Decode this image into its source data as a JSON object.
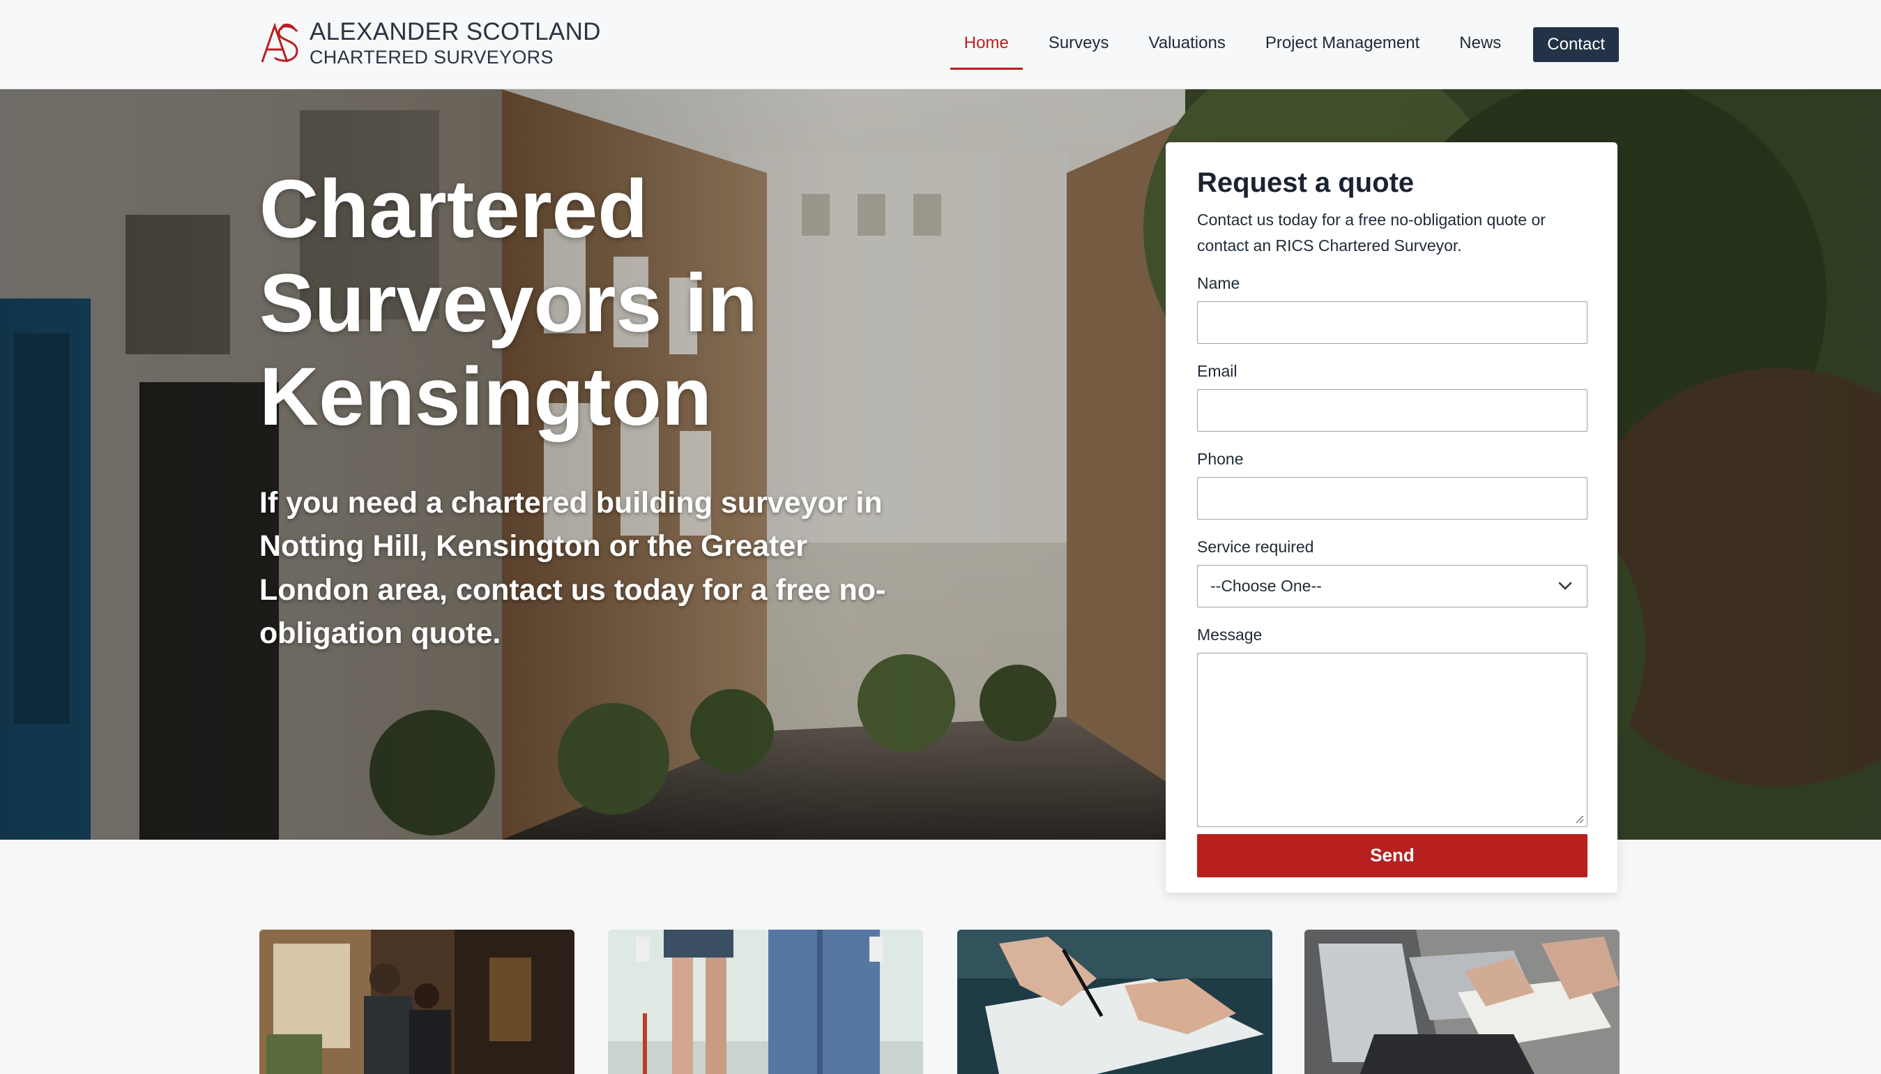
{
  "brand": {
    "name_line1": "ALEXANDER SCOTLAND",
    "name_line2": "CHARTERED SURVEYORS",
    "colors": {
      "accent": "#b81f1f",
      "navy": "#233246"
    }
  },
  "nav": {
    "items": [
      {
        "label": "Home",
        "active": true
      },
      {
        "label": "Surveys",
        "active": false
      },
      {
        "label": "Valuations",
        "active": false
      },
      {
        "label": "Project Management",
        "active": false
      },
      {
        "label": "News",
        "active": false
      }
    ],
    "contact_label": "Contact"
  },
  "hero": {
    "title": "Chartered Surveyors in Kensington",
    "subtitle": "If you need a chartered building surveyor in Notting Hill, Kensington or the Greater London area, contact us today for a free no-obligation quote."
  },
  "quote_form": {
    "title": "Request a quote",
    "intro": "Contact us today for a free no-obligation quote or contact an RICS Chartered Surveyor.",
    "fields": {
      "name_label": "Name",
      "email_label": "Email",
      "phone_label": "Phone",
      "service_label": "Service required",
      "service_selected": "--Choose One--",
      "message_label": "Message"
    },
    "submit_label": "Send"
  },
  "cards": [
    {
      "image": "couple-in-kitchen-photo"
    },
    {
      "image": "decorators-legs-photo"
    },
    {
      "image": "signing-document-photo"
    },
    {
      "image": "laptop-paperwork-photo"
    }
  ]
}
